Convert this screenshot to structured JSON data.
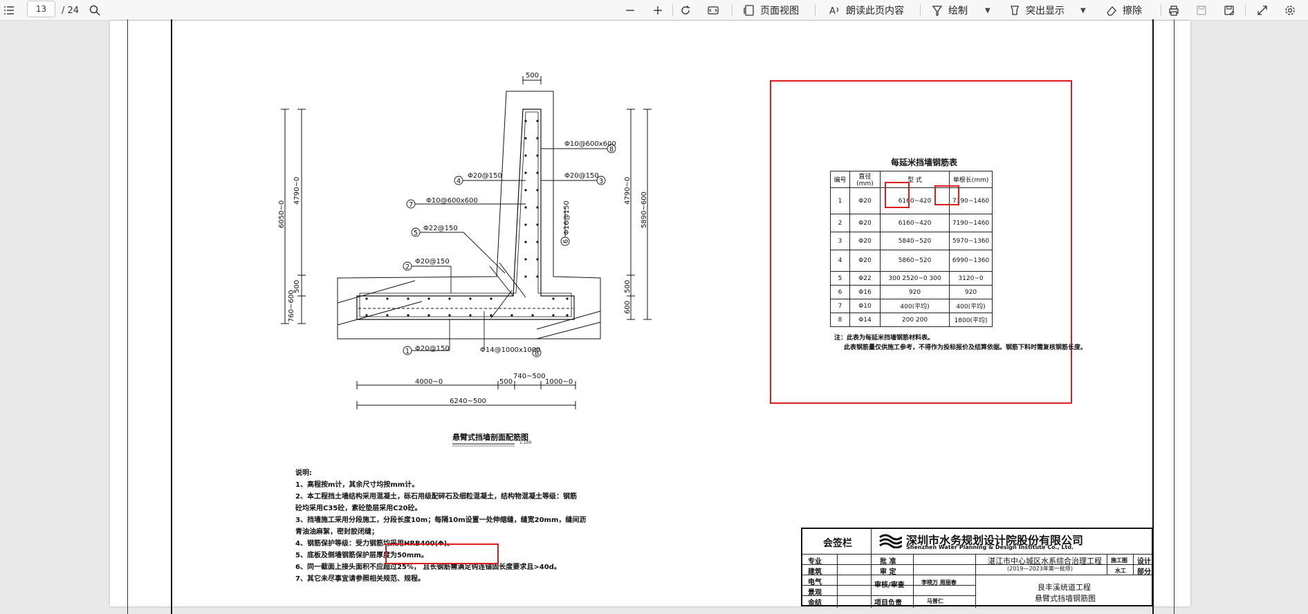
{
  "toolbar": {
    "page_current": "13",
    "page_total": "/ 24",
    "page_view": "页面视图",
    "read_aloud": "朗读此页内容",
    "draw": "绘制",
    "highlight": "突出显示",
    "erase": "擦除"
  },
  "drawing": {
    "caption": "悬臂式挡墙剖面配筋图",
    "caption_scale": "1:100",
    "dims": {
      "top_width": "500",
      "left_total": "6050~0",
      "left_upper": "4790~0",
      "left_500": "500",
      "left_base": "760~600",
      "right_upper": "4790~0",
      "right_total": "5890~600",
      "right_500": "500",
      "right_base": "600",
      "bottom_4000": "4000~0",
      "bottom_500": "500",
      "bottom_740": "740~500",
      "bottom_1000": "1000~0",
      "bottom_total": "6240~500"
    },
    "rebar_labels": [
      {
        "num": "8",
        "text": "Φ10@600x600"
      },
      {
        "num": "4",
        "text": "Φ20@150"
      },
      {
        "num": "3",
        "text": "Φ20@150"
      },
      {
        "num": "7",
        "text": "Φ10@600x600"
      },
      {
        "num": "5",
        "text": "Φ22@150"
      },
      {
        "num": "6",
        "text": "Φ16@150"
      },
      {
        "num": "2",
        "text": "Φ20@150"
      },
      {
        "num": "1",
        "text": "Φ20@150"
      },
      {
        "num": "8",
        "text": "Φ14@1000x1000"
      }
    ]
  },
  "notes": {
    "heading": "说明:",
    "lines": [
      "1、高程按m计，其余尺寸均按mm计。",
      "2、本工程挡土墙结构采用混凝土，砾石用级配碎石及细粒混凝土，结构物混凝土等级：钢筋",
      "砼均采用C35砼，素砼垫层采用C20砼。",
      "3、挡墙施工采用分段施工，分段长度10m；每隔10m设置一处伸缩缝，缝宽20mm，缝间沥",
      "青油油麻絮，密封胶闭缝；",
      "4、钢筋保护等级：受力钢筋均采用HRB400(Φ)。",
      "5、底板及侧墙钢筋保护层厚度为50mm。",
      "6、同一截面上接头面积不应超过25%，",
      "7、其它未尽事宜请参照相关规范、规程。"
    ],
    "highlighted": "且长钢筋需满足钩连锚固长度要求且>40d。"
  },
  "rebar_table": {
    "title": "每延米挡墙钢筋表",
    "headers": [
      "编号",
      "直径(mm)",
      "型 式",
      "单根长(mm)"
    ],
    "rows": [
      {
        "no": "1",
        "dia": "Φ20",
        "shape": "6160~420",
        "len": "7190~1460"
      },
      {
        "no": "2",
        "dia": "Φ20",
        "shape": "6160~420",
        "len": "7190~1460"
      },
      {
        "no": "3",
        "dia": "Φ20",
        "shape": "5840~520",
        "len": "5970~1360"
      },
      {
        "no": "4",
        "dia": "Φ20",
        "shape": "5860~520",
        "len": "6990~1360"
      },
      {
        "no": "5",
        "dia": "Φ22",
        "shape": "300  2520~0  300",
        "len": "3120~0"
      },
      {
        "no": "6",
        "dia": "Φ16",
        "shape": "920",
        "len": "920"
      },
      {
        "no": "7",
        "dia": "Φ10",
        "shape": "400(平均)",
        "len": "400(平均)"
      },
      {
        "no": "8",
        "dia": "Φ14",
        "shape": "200  200",
        "len": "1800(平均)"
      }
    ],
    "note_line1": "注：此表为每延米挡墙钢筋材料表。",
    "note_line2": "此表钢筋量仅供施工参考，不得作为投标报价及结算依据。钢筋下料时需复核钢筋长度。"
  },
  "titleblock": {
    "sign_label": "会签栏",
    "company_cn": "深圳市水务规划设计院股份有限公司",
    "company_en": "Shenzhen Water Planning & Design Institute Co., Ltd.",
    "rows_left": [
      "专业",
      "建筑",
      "电气",
      "景观",
      "金结"
    ],
    "rows_mid": [
      "批 准",
      "审 定",
      "审核/审查",
      "",
      "项目负责"
    ],
    "signers": [
      "李晓万 周丽春",
      "马普仁"
    ],
    "project_line1": "湛江市中心城区水系综合治理工程",
    "project_line2": "(2019—2023年第一批项)",
    "stage_label": "施工图",
    "stage_value": "设计",
    "part_label": "水工",
    "part_value": "部分",
    "drawing_line1": "良丰溪统道工程",
    "drawing_line2": "悬臂式挡墙钢筋图"
  }
}
